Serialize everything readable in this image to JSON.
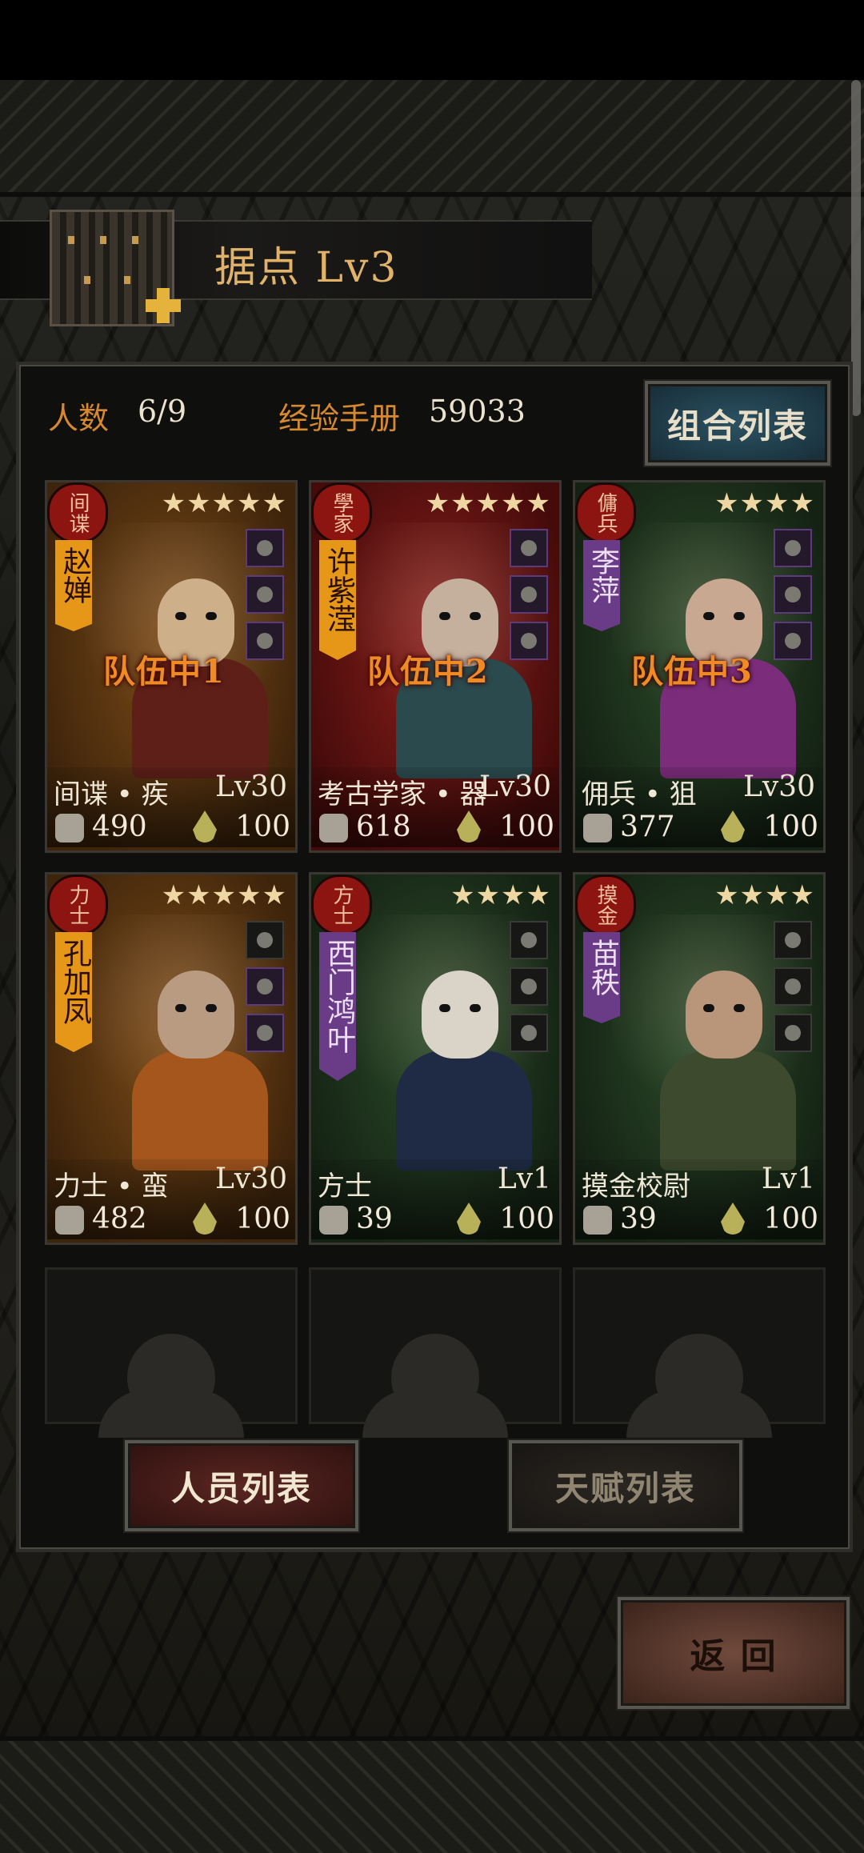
{
  "header": {
    "title": "据点 Lv3"
  },
  "stats": {
    "member_label": "人数",
    "member_value": "6/9",
    "exp_label": "经验手册",
    "exp_value": "59033"
  },
  "buttons": {
    "combo_list": "组合列表",
    "roster_list": "人员列表",
    "talent_list": "天赋列表",
    "back": "返 回"
  },
  "colors": {
    "accent_orange": "#d6892f",
    "title_gold": "#e1b36a",
    "rarity_orange": "#7a4a17",
    "rarity_red": "#8a1f1c",
    "rarity_green": "#2c4a2a"
  },
  "cards": [
    {
      "seal": "间谍",
      "name": "赵婵",
      "stars": "★★★★★",
      "team": "队伍中1",
      "class_line": "间谍 • 疾",
      "level": "Lv30",
      "power": "490",
      "stamina": "100"
    },
    {
      "seal": "學家",
      "name": "许紫滢",
      "stars": "★★★★★",
      "team": "队伍中2",
      "class_line": "考古学家 • 器",
      "level": "Lv30",
      "power": "618",
      "stamina": "100"
    },
    {
      "seal": "傭兵",
      "name": "李萍",
      "stars": "★★★★",
      "team": "队伍中3",
      "class_line": "佣兵 • 狙",
      "level": "Lv30",
      "power": "377",
      "stamina": "100"
    },
    {
      "seal": "力士",
      "name": "孔加凤",
      "stars": "★★★★★",
      "team": "",
      "class_line": "力士 • 蛮",
      "level": "Lv30",
      "power": "482",
      "stamina": "100"
    },
    {
      "seal": "方士",
      "name": "西门鸿叶",
      "stars": "★★★★",
      "team": "",
      "class_line": "方士",
      "level": "Lv1",
      "power": "39",
      "stamina": "100"
    },
    {
      "seal": "摸金",
      "name": "苗秩",
      "stars": "★★★★",
      "team": "",
      "class_line": "摸金校尉",
      "level": "Lv1",
      "power": "39",
      "stamina": "100"
    }
  ]
}
